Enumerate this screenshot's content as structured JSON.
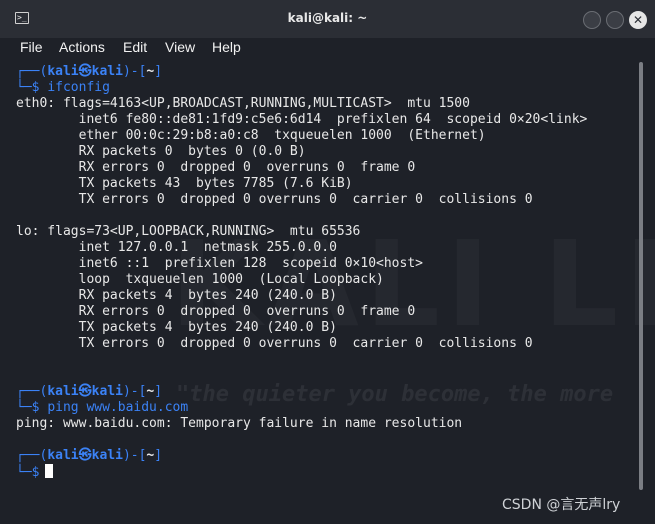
{
  "window": {
    "title": "kali@kali: ~",
    "terminal_icon": "terminal-icon",
    "controls": [
      "minimize",
      "maximize",
      "close"
    ]
  },
  "menu": [
    "File",
    "Actions",
    "Edit",
    "View",
    "Help"
  ],
  "prompt": {
    "open": "┌──(",
    "user": "kali㉿kali",
    "mid": ")-[",
    "cwd": "~",
    "close": "]",
    "second_prefix": "└─$"
  },
  "lines": [
    {
      "kind": "prompt1"
    },
    {
      "kind": "command",
      "text": "ifconfig"
    },
    {
      "kind": "out",
      "text": "eth0: flags=4163<UP,BROADCAST,RUNNING,MULTICAST>  mtu 1500"
    },
    {
      "kind": "out",
      "text": "        inet6 fe80::de81:1fd9:c5e6:6d14  prefixlen 64  scopeid 0×20<link>"
    },
    {
      "kind": "out",
      "text": "        ether 00:0c:29:b8:a0:c8  txqueuelen 1000  (Ethernet)"
    },
    {
      "kind": "out",
      "text": "        RX packets 0  bytes 0 (0.0 B)"
    },
    {
      "kind": "out",
      "text": "        RX errors 0  dropped 0  overruns 0  frame 0"
    },
    {
      "kind": "out",
      "text": "        TX packets 43  bytes 7785 (7.6 KiB)"
    },
    {
      "kind": "out",
      "text": "        TX errors 0  dropped 0 overruns 0  carrier 0  collisions 0"
    },
    {
      "kind": "out",
      "text": ""
    },
    {
      "kind": "out",
      "text": "lo: flags=73<UP,LOOPBACK,RUNNING>  mtu 65536"
    },
    {
      "kind": "out",
      "text": "        inet 127.0.0.1  netmask 255.0.0.0"
    },
    {
      "kind": "out",
      "text": "        inet6 ::1  prefixlen 128  scopeid 0×10<host>"
    },
    {
      "kind": "out",
      "text": "        loop  txqueuelen 1000  (Local Loopback)"
    },
    {
      "kind": "out",
      "text": "        RX packets 4  bytes 240 (240.0 B)"
    },
    {
      "kind": "out",
      "text": "        RX errors 0  dropped 0  overruns 0  frame 0"
    },
    {
      "kind": "out",
      "text": "        TX packets 4  bytes 240 (240.0 B)"
    },
    {
      "kind": "out",
      "text": "        TX errors 0  dropped 0 overruns 0  carrier 0  collisions 0"
    },
    {
      "kind": "out",
      "text": ""
    },
    {
      "kind": "out",
      "text": ""
    },
    {
      "kind": "prompt1"
    },
    {
      "kind": "command",
      "text": "ping www.baidu.com"
    },
    {
      "kind": "out",
      "text": "ping: www.baidu.com: Temporary failure in name resolution"
    },
    {
      "kind": "out",
      "text": ""
    },
    {
      "kind": "prompt1"
    },
    {
      "kind": "cursor"
    }
  ],
  "watermark": {
    "text": "KALI LI",
    "quote": "\"the quieter you become, the more"
  },
  "credit": "CSDN @言无声lry",
  "colors": {
    "background": "#1e2128",
    "titlebar": "#2b2e35",
    "prompt_blue": "#3b82f6",
    "text": "#e8e8e8"
  }
}
